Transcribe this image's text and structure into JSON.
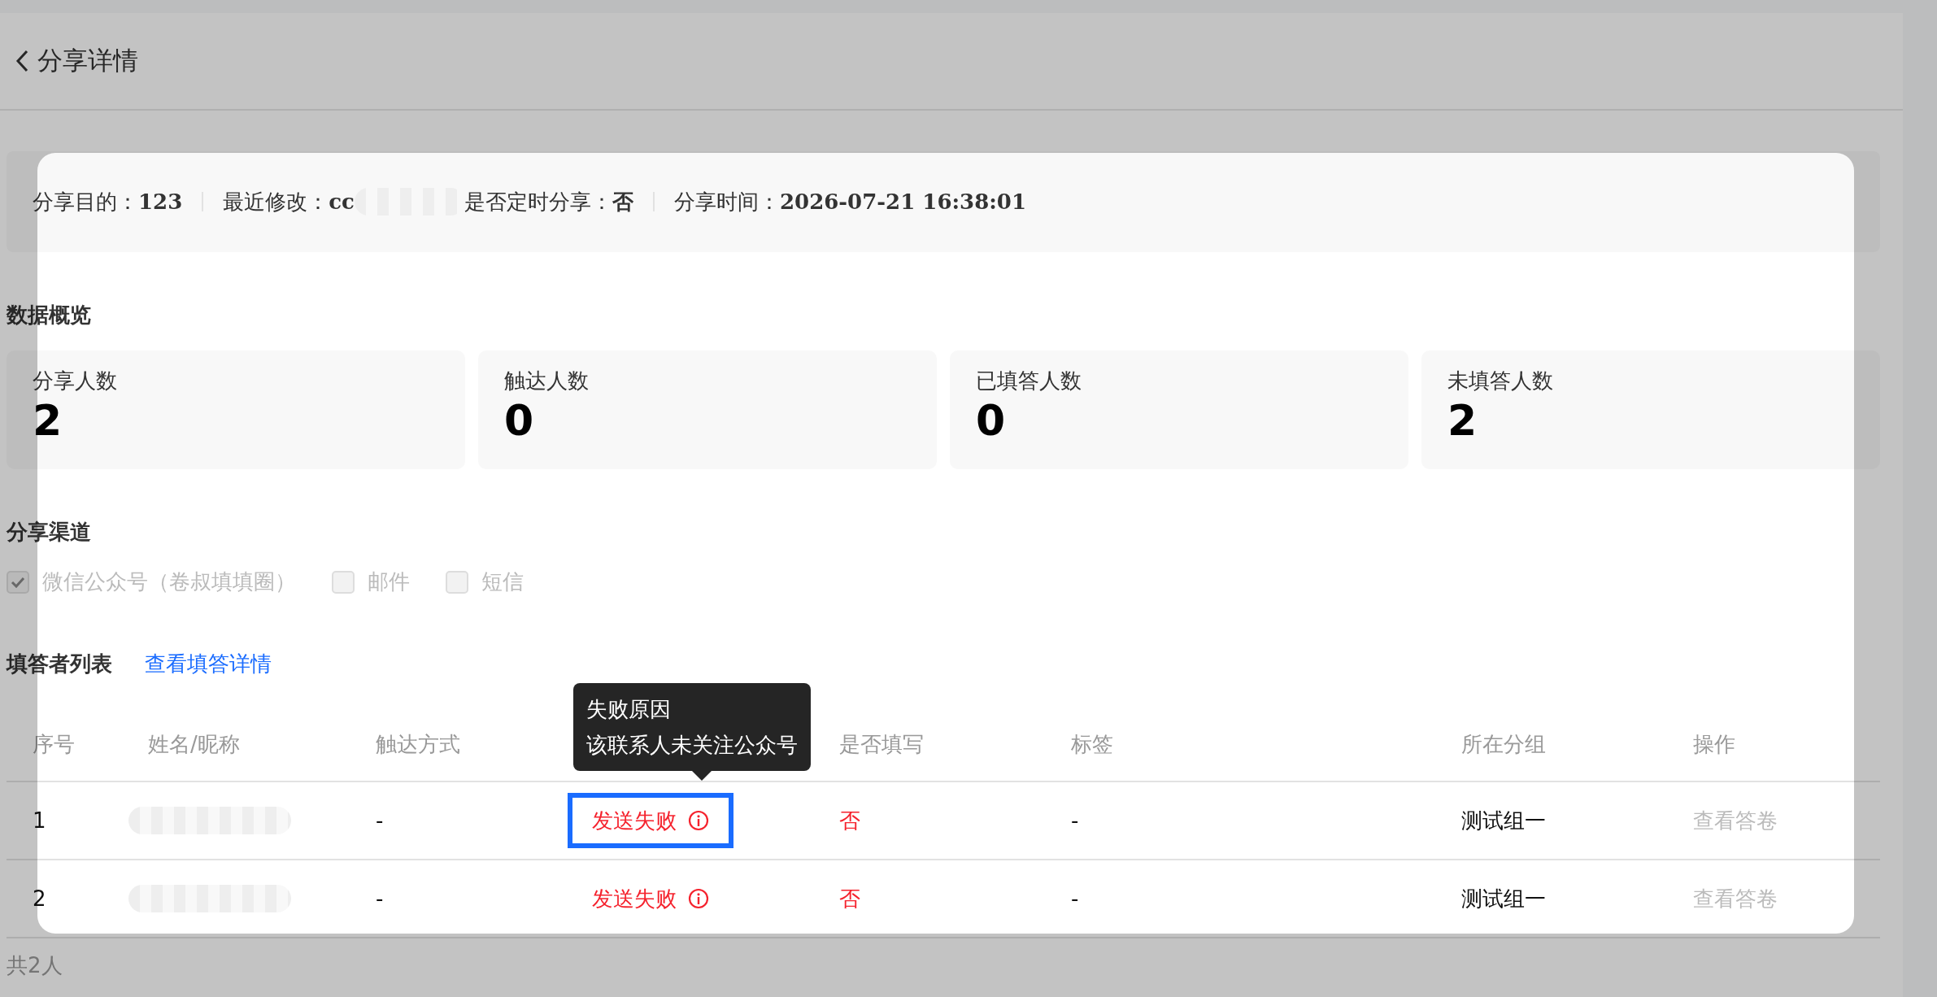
{
  "header": {
    "title": "分享详情"
  },
  "summary": [
    {
      "label": "分享目的：",
      "value": "123",
      "blurred": false
    },
    {
      "label": "最近修改：",
      "value": "cc",
      "blurred": true
    },
    {
      "label": "是否定时分享：",
      "value": "否",
      "blurred": false
    },
    {
      "label": "分享时间：",
      "value": "2026-07-21 16:38:01",
      "blurred": false
    }
  ],
  "overview": {
    "title": "数据概览",
    "stats": [
      {
        "label": "分享人数",
        "value": "2"
      },
      {
        "label": "触达人数",
        "value": "0"
      },
      {
        "label": "已填答人数",
        "value": "0"
      },
      {
        "label": "未填答人数",
        "value": "2"
      }
    ]
  },
  "channels": {
    "title": "分享渠道",
    "options": [
      {
        "label": "微信公众号（卷叔填填圈）",
        "checked": true,
        "disabled": true
      },
      {
        "label": "邮件",
        "checked": false,
        "disabled": true
      },
      {
        "label": "短信",
        "checked": false,
        "disabled": true
      }
    ]
  },
  "respondents": {
    "title": "填答者列表",
    "link": "查看填答详情",
    "columns": [
      {
        "kind": "text",
        "label": "序号"
      },
      {
        "kind": "text",
        "label": "姓名/昵称"
      },
      {
        "kind": "text",
        "label": "触达方式"
      },
      {
        "kind": "covered"
      },
      {
        "kind": "text",
        "label": "是否填写"
      },
      {
        "kind": "text",
        "label": "标签"
      },
      {
        "kind": "text",
        "label": "所在分组"
      },
      {
        "kind": "text",
        "label": "操作"
      }
    ],
    "rows": [
      {
        "index": "1",
        "name_blurred": true,
        "method": "-",
        "status": {
          "text": "发送失败",
          "highlighted": true,
          "tooltip": {
            "title": "失败原因",
            "message": "该联系人未关注公众号"
          }
        },
        "filled": "否",
        "tag": "-",
        "group": "测试组一",
        "action": {
          "label": "查看答卷",
          "disabled": true
        }
      },
      {
        "index": "2",
        "name_blurred": true,
        "method": "-",
        "status": {
          "text": "发送失败",
          "highlighted": false
        },
        "filled": "否",
        "tag": "-",
        "group": "测试组一",
        "action": {
          "label": "查看答卷",
          "disabled": true
        }
      }
    ],
    "total": "共2人"
  }
}
